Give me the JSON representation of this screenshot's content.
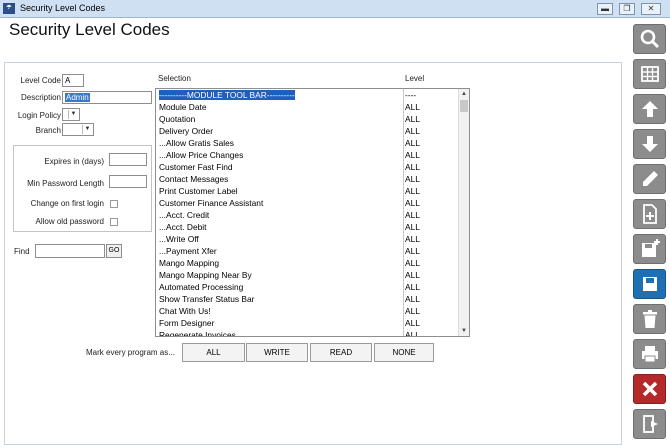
{
  "window": {
    "title": "Security Level Codes",
    "minimize_glyph": "▬",
    "restore_glyph": "❐",
    "close_glyph": "✕"
  },
  "page": {
    "title": "Security Level Codes"
  },
  "form": {
    "level_code_label": "Level Code",
    "level_code_value": "A",
    "description_label": "Description",
    "description_value": "Admin",
    "login_policy_label": "Login Policy",
    "branch_label": "Branch",
    "expires_label": "Expires in (days)",
    "min_password_label": "Min Password Length",
    "change_first_login_label": "Change on first login",
    "allow_old_password_label": "Allow old password",
    "find_label": "Find",
    "go_label": "GO"
  },
  "selection": {
    "column_selection": "Selection",
    "column_level": "Level",
    "rows": [
      {
        "name": "----------MODULE TOOL BAR----------",
        "level": "----"
      },
      {
        "name": "Module Date",
        "level": "ALL"
      },
      {
        "name": "Quotation",
        "level": "ALL"
      },
      {
        "name": "Delivery Order",
        "level": "ALL"
      },
      {
        "name": "...Allow Gratis Sales",
        "level": "ALL"
      },
      {
        "name": "...Allow Price Changes",
        "level": "ALL"
      },
      {
        "name": "Customer Fast Find",
        "level": "ALL"
      },
      {
        "name": "Contact Messages",
        "level": "ALL"
      },
      {
        "name": "Print Customer Label",
        "level": "ALL"
      },
      {
        "name": "Customer Finance Assistant",
        "level": "ALL"
      },
      {
        "name": "...Acct. Credit",
        "level": "ALL"
      },
      {
        "name": "...Acct. Debit",
        "level": "ALL"
      },
      {
        "name": "...Write Off",
        "level": "ALL"
      },
      {
        "name": "...Payment Xfer",
        "level": "ALL"
      },
      {
        "name": "Mango Mapping",
        "level": "ALL"
      },
      {
        "name": "Mango Mapping Near By",
        "level": "ALL"
      },
      {
        "name": "Automated Processing",
        "level": "ALL"
      },
      {
        "name": "Show Transfer Status Bar",
        "level": "ALL"
      },
      {
        "name": "Chat With Us!",
        "level": "ALL"
      },
      {
        "name": "Form Designer",
        "level": "ALL"
      },
      {
        "name": "Regenerate Invoices",
        "level": "ALL"
      }
    ]
  },
  "mark": {
    "label": "Mark every program as...",
    "all": "ALL",
    "write": "WRITE",
    "read": "READ",
    "none": "NONE"
  },
  "toolbar": {
    "icons": [
      "search-icon",
      "grid-icon",
      "arrow-up-icon",
      "arrow-down-icon",
      "pencil-icon",
      "new-document-icon",
      "save-new-icon",
      "save-icon",
      "trash-icon",
      "print-icon",
      "close-icon",
      "exit-door-icon"
    ],
    "colors": {
      "gray": "#8c8c8c",
      "blue": "#1f6fb3",
      "red": "#b42a2a"
    }
  }
}
